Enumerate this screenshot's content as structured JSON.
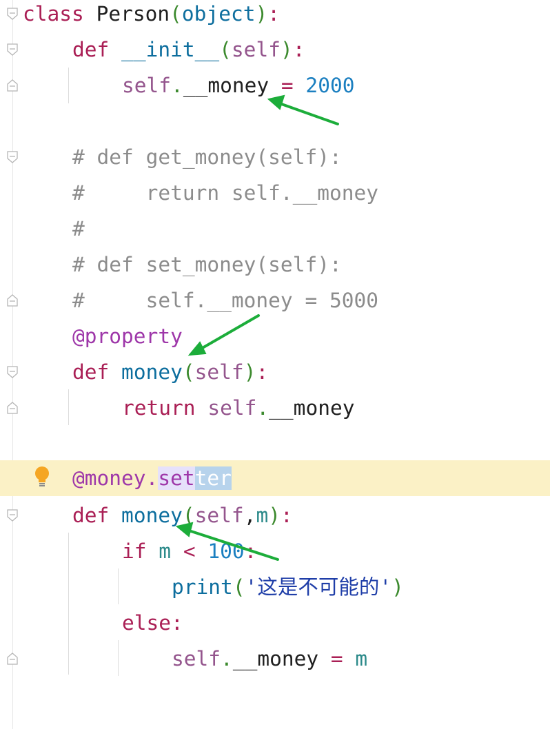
{
  "lines": {
    "l1": {
      "kw": "class",
      "name": " Person",
      "open": "(",
      "base": "object",
      "close": ")",
      "colon": ":"
    },
    "l2": {
      "kw": "def",
      "fn": " __init__",
      "open": "(",
      "self": "self",
      "close": ")",
      "colon": ":"
    },
    "l3": {
      "self": "self",
      "dot": ".",
      "attr": "__money ",
      "eq": "=",
      "num": " 2000"
    },
    "l5": {
      "text": "# def get_money(self):"
    },
    "l6": {
      "text": "#     return self.__money"
    },
    "l7": {
      "text": "#"
    },
    "l8": {
      "text": "# def set_money(self):"
    },
    "l9": {
      "text": "#     self.__money = 5000"
    },
    "l10": {
      "deco": "@property"
    },
    "l11": {
      "kw": "def",
      "fn": " money",
      "open": "(",
      "self": "self",
      "close": ")",
      "colon": ":"
    },
    "l12": {
      "kw": "return",
      "self": " self",
      "dot": ".",
      "attr": "__money"
    },
    "l14": {
      "deco1": "@money.",
      "deco2": "set",
      "deco3": "ter"
    },
    "l15": {
      "kw": "def",
      "fn": " money",
      "open": "(",
      "self": "self",
      "comma": ",",
      "param": "m",
      "close": ")",
      "colon": ":"
    },
    "l16": {
      "kw": "if",
      "param": " m",
      "op": " <",
      "num": " 100",
      "colon": ":"
    },
    "l17": {
      "fn": "print",
      "open": "(",
      "str": "'这是不可能的'",
      "close": ")"
    },
    "l18": {
      "kw": "else",
      "colon": ":"
    },
    "l19": {
      "self": "self",
      "dot": ".",
      "attr": "__money ",
      "eq": "=",
      "param": " m"
    }
  },
  "colors": {
    "arrow": "#1cad3a",
    "current_line": "#fbf1c6",
    "bulb": "#f5a623"
  },
  "icons": {
    "intention": "lightbulb-icon",
    "fold": "fold-marker-icon"
  }
}
